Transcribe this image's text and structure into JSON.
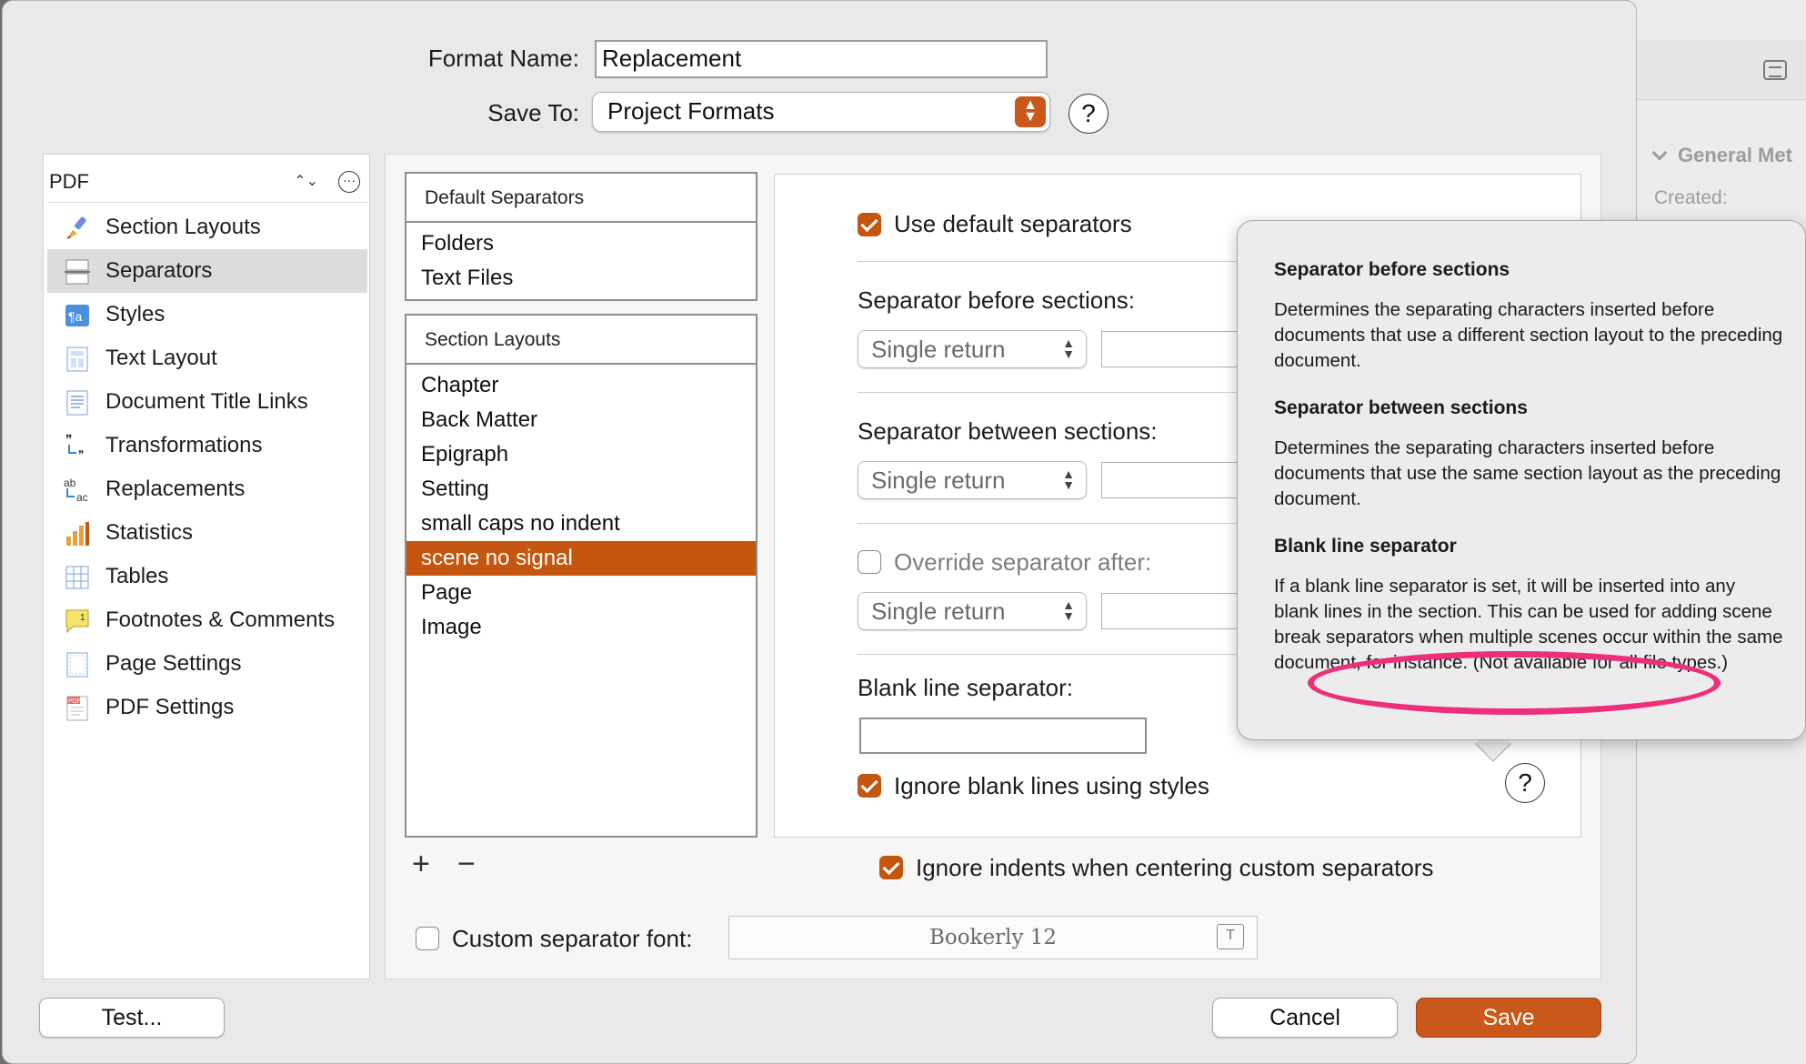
{
  "background_window": {
    "section_label": "General Met",
    "created_label": "Created:"
  },
  "header": {
    "format_name_label": "Format Name:",
    "format_name_value": "Replacement",
    "save_to_label": "Save To:",
    "save_to_value": "Project Formats",
    "help_label": "?"
  },
  "sidebar": {
    "format_selector": "PDF",
    "items": [
      {
        "label": "Section Layouts",
        "icon": "brush-icon"
      },
      {
        "label": "Separators",
        "icon": "separators-icon",
        "selected": true
      },
      {
        "label": "Styles",
        "icon": "styles-icon"
      },
      {
        "label": "Text Layout",
        "icon": "text-layout-icon"
      },
      {
        "label": "Document Title Links",
        "icon": "document-icon"
      },
      {
        "label": "Transformations",
        "icon": "transformations-icon"
      },
      {
        "label": "Replacements",
        "icon": "replacements-icon"
      },
      {
        "label": "Statistics",
        "icon": "statistics-icon"
      },
      {
        "label": "Tables",
        "icon": "tables-icon"
      },
      {
        "label": "Footnotes & Comments",
        "icon": "footnotes-icon"
      },
      {
        "label": "Page Settings",
        "icon": "page-settings-icon"
      },
      {
        "label": "PDF Settings",
        "icon": "pdf-icon"
      }
    ]
  },
  "default_separators_list": {
    "header": "Default Separators",
    "items": [
      "Folders",
      "Text Files"
    ]
  },
  "section_layouts_list": {
    "header": "Section Layouts",
    "items": [
      "Chapter",
      "Back Matter",
      "Epigraph",
      "Setting",
      "small caps no indent",
      "scene no signal",
      "Page",
      "Image"
    ],
    "selected_index": 5
  },
  "list_controls": {
    "add": "+",
    "remove": "−"
  },
  "settings": {
    "use_default_label": "Use default separators",
    "before_label": "Separator before sections:",
    "before_value": "Single return",
    "between_label": "Separator between sections:",
    "between_value": "Single return",
    "override_label": "Override separator after:",
    "override_value": "Single return",
    "blank_line_label": "Blank line separator:",
    "ignore_blank_label": "Ignore blank lines using styles",
    "help_label": "?"
  },
  "ignore_indents_label": "Ignore indents when centering custom separators",
  "custom_font_label": "Custom separator font:",
  "custom_font_value": "Bookerly 12",
  "popover": {
    "sections": [
      {
        "title": "Separator before sections",
        "body": "Determines the separating characters inserted before documents that use a different section layout to the preceding document."
      },
      {
        "title": "Separator between sections",
        "body": "Determines the separating characters inserted before documents that use the same section layout as the preceding document."
      },
      {
        "title": "Blank line separator",
        "body": "If a blank line separator is set, it will be inserted into any blank lines in the section. This can be used for adding scene break separators when multiple scenes occur within the same document, for instance. (Not available for all file types.)"
      }
    ]
  },
  "buttons": {
    "test": "Test...",
    "cancel": "Cancel",
    "save": "Save"
  },
  "colors": {
    "accent": "#c4560f",
    "annotation": "#ec2f78"
  }
}
